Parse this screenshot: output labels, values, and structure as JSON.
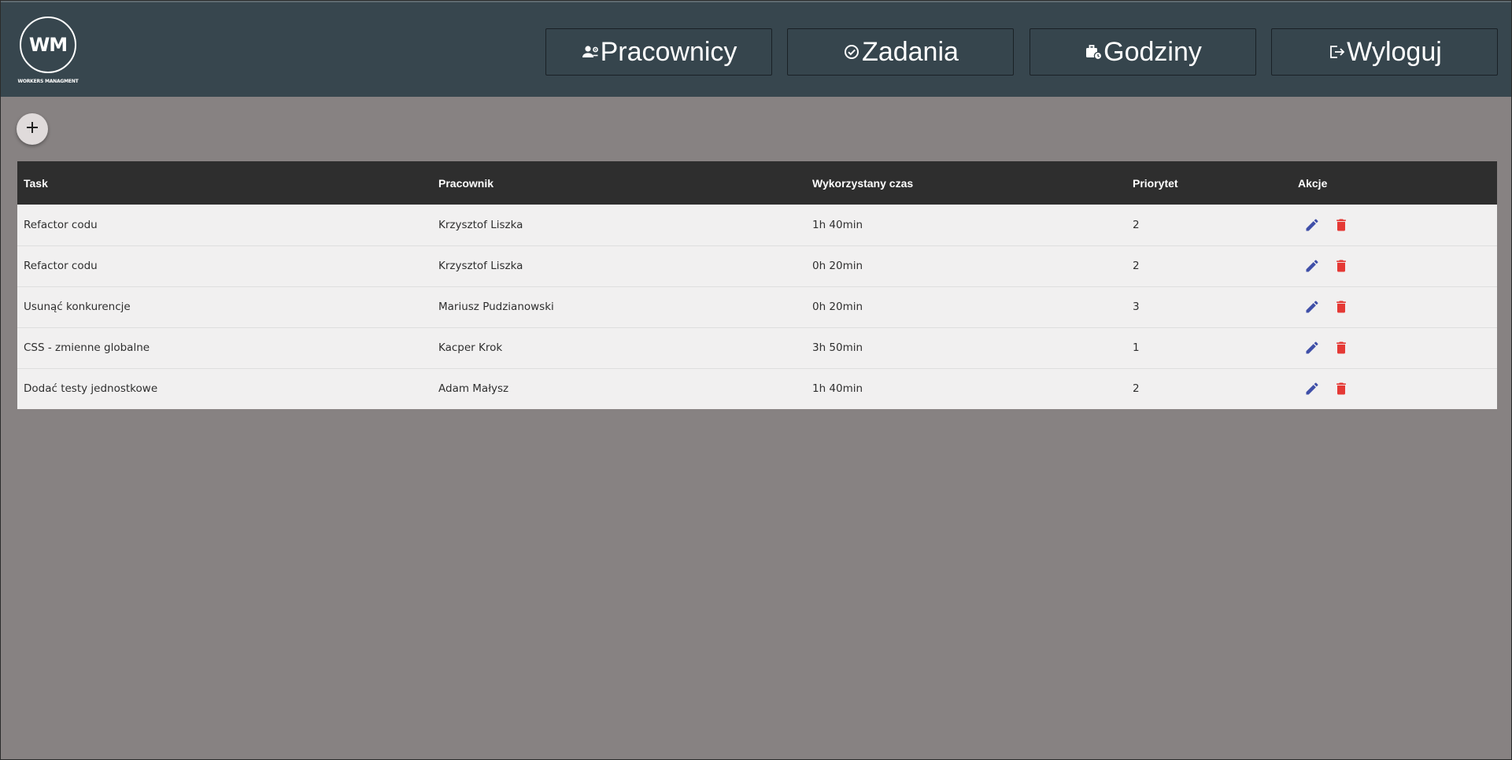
{
  "brand": {
    "logo_text": "WM",
    "caption": "WORKERS MANAGMENT"
  },
  "nav": [
    {
      "label": "Pracownicy",
      "icon": "people-settings-icon"
    },
    {
      "label": "Zadania",
      "icon": "check-circle-icon"
    },
    {
      "label": "Godziny",
      "icon": "briefcase-clock-icon"
    },
    {
      "label": "Wyloguj",
      "icon": "logout-icon"
    }
  ],
  "add_button": {
    "icon": "plus-icon"
  },
  "table": {
    "columns": [
      "Task",
      "Pracownik",
      "Wykorzystany czas",
      "Priorytet",
      "Akcje"
    ],
    "rows": [
      {
        "task": "Refactor codu",
        "worker": "Krzysztof Liszka",
        "time": "1h 40min",
        "priority": "2"
      },
      {
        "task": "Refactor codu",
        "worker": "Krzysztof Liszka",
        "time": "0h 20min",
        "priority": "2"
      },
      {
        "task": "Usunąć konkurencje",
        "worker": "Mariusz Pudzianowski",
        "time": "0h 20min",
        "priority": "3"
      },
      {
        "task": "CSS - zmienne globalne",
        "worker": "Kacper Krok",
        "time": "3h 50min",
        "priority": "1"
      },
      {
        "task": "Dodać testy jednostkowe",
        "worker": "Adam Małysz",
        "time": "1h 40min",
        "priority": "2"
      }
    ]
  },
  "colors": {
    "header_bg": "#37464e",
    "page_bg": "#878282",
    "table_head_bg": "#2e2e2e",
    "row_bg": "#f1f0f0",
    "edit_icon": "#3f4fa8",
    "delete_icon": "#e53935"
  }
}
